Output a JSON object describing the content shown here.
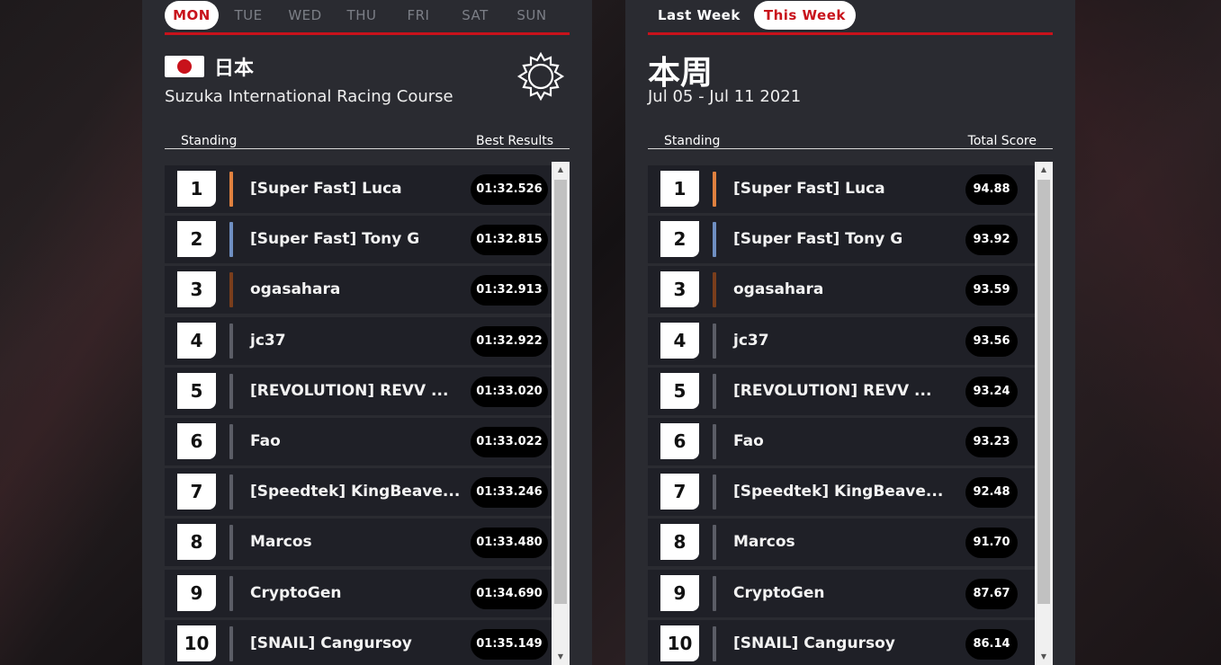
{
  "left_panel": {
    "days": [
      {
        "label": "MON",
        "active": true
      },
      {
        "label": "TUE",
        "active": false
      },
      {
        "label": "WED",
        "active": false
      },
      {
        "label": "THU",
        "active": false
      },
      {
        "label": "FRI",
        "active": false
      },
      {
        "label": "SAT",
        "active": false
      },
      {
        "label": "SUN",
        "active": false
      }
    ],
    "country": "日本",
    "track": "Suzuka International Racing Course",
    "weather_icon": "sun-icon",
    "col_standing": "Standing",
    "col_result": "Best Results",
    "rows": [
      {
        "rank": "1",
        "name": "[Super Fast] Luca",
        "value": "01:32.526",
        "accent": "#e0813f"
      },
      {
        "rank": "2",
        "name": "[Super Fast] Tony G",
        "value": "01:32.815",
        "accent": "#6f8fc2"
      },
      {
        "rank": "3",
        "name": "ogasahara",
        "value": "01:32.913",
        "accent": "#7a3e1c"
      },
      {
        "rank": "4",
        "name": "jc37",
        "value": "01:32.922",
        "accent": "#5b5d66"
      },
      {
        "rank": "5",
        "name": "[REVOLUTION] REVV ...",
        "value": "01:33.020",
        "accent": "#5b5d66"
      },
      {
        "rank": "6",
        "name": "Fao",
        "value": "01:33.022",
        "accent": "#5b5d66"
      },
      {
        "rank": "7",
        "name": "[Speedtek] KingBeave...",
        "value": "01:33.246",
        "accent": "#5b5d66"
      },
      {
        "rank": "8",
        "name": "Marcos",
        "value": "01:33.480",
        "accent": "#5b5d66"
      },
      {
        "rank": "9",
        "name": "CryptoGen",
        "value": "01:34.690",
        "accent": "#5b5d66"
      },
      {
        "rank": "10",
        "name": "[SNAIL] Cangursoy",
        "value": "01:35.149",
        "accent": "#5b5d66"
      }
    ]
  },
  "right_panel": {
    "tabs": [
      {
        "label": "Last Week",
        "active": false
      },
      {
        "label": "This Week",
        "active": true
      }
    ],
    "title": "本周",
    "date_range": "Jul 05 - Jul 11 2021",
    "col_standing": "Standing",
    "col_result": "Total Score",
    "rows": [
      {
        "rank": "1",
        "name": "[Super Fast] Luca",
        "value": "94.88",
        "accent": "#e0813f"
      },
      {
        "rank": "2",
        "name": "[Super Fast] Tony G",
        "value": "93.92",
        "accent": "#6f8fc2"
      },
      {
        "rank": "3",
        "name": "ogasahara",
        "value": "93.59",
        "accent": "#7a3e1c"
      },
      {
        "rank": "4",
        "name": "jc37",
        "value": "93.56",
        "accent": "#5b5d66"
      },
      {
        "rank": "5",
        "name": "[REVOLUTION] REVV ...",
        "value": "93.24",
        "accent": "#5b5d66"
      },
      {
        "rank": "6",
        "name": "Fao",
        "value": "93.23",
        "accent": "#5b5d66"
      },
      {
        "rank": "7",
        "name": "[Speedtek] KingBeave...",
        "value": "92.48",
        "accent": "#5b5d66"
      },
      {
        "rank": "8",
        "name": "Marcos",
        "value": "91.70",
        "accent": "#5b5d66"
      },
      {
        "rank": "9",
        "name": "CryptoGen",
        "value": "87.67",
        "accent": "#5b5d66"
      },
      {
        "rank": "10",
        "name": "[SNAIL] Cangursoy",
        "value": "86.14",
        "accent": "#5b5d66"
      }
    ]
  },
  "colors": {
    "brand_red": "#c8121b",
    "panel_bg": "#2a2b31",
    "row_bg": "#1f2027"
  }
}
